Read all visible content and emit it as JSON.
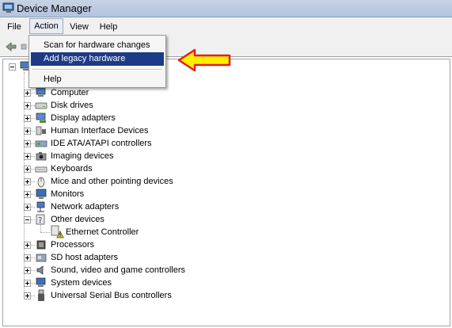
{
  "window": {
    "title": "Device Manager"
  },
  "menubar": {
    "items": [
      "File",
      "Action",
      "View",
      "Help"
    ]
  },
  "action_menu": {
    "items": [
      "Scan for hardware changes",
      "Add legacy hardware"
    ],
    "help": "Help",
    "highlighted": "Add legacy hardware"
  },
  "tree": {
    "categories": [
      {
        "label": "Computer",
        "icon": "computer-icon"
      },
      {
        "label": "Disk drives",
        "icon": "disk-drive-icon"
      },
      {
        "label": "Display adapters",
        "icon": "display-adapter-icon"
      },
      {
        "label": "Human Interface Devices",
        "icon": "hid-icon"
      },
      {
        "label": "IDE ATA/ATAPI controllers",
        "icon": "ide-controller-icon"
      },
      {
        "label": "Imaging devices",
        "icon": "camera-icon"
      },
      {
        "label": "Keyboards",
        "icon": "keyboard-icon"
      },
      {
        "label": "Mice and other pointing devices",
        "icon": "mouse-icon"
      },
      {
        "label": "Monitors",
        "icon": "monitor-icon"
      },
      {
        "label": "Network adapters",
        "icon": "network-adapter-icon"
      },
      {
        "label": "Other devices",
        "icon": "other-devices-icon",
        "expanded": true
      },
      {
        "label": "Processors",
        "icon": "processor-icon"
      },
      {
        "label": "SD host adapters",
        "icon": "sd-host-icon"
      },
      {
        "label": "Sound, video and game controllers",
        "icon": "speaker-icon"
      },
      {
        "label": "System devices",
        "icon": "system-devices-icon"
      },
      {
        "label": "Universal Serial Bus controllers",
        "icon": "usb-icon"
      }
    ],
    "other_devices_child": {
      "label": "Ethernet Controller",
      "icon": "warning-device-icon"
    }
  },
  "colors": {
    "highlight": "#1d3a87",
    "arrow_fill": "#ffee00",
    "arrow_stroke": "#e02020"
  }
}
